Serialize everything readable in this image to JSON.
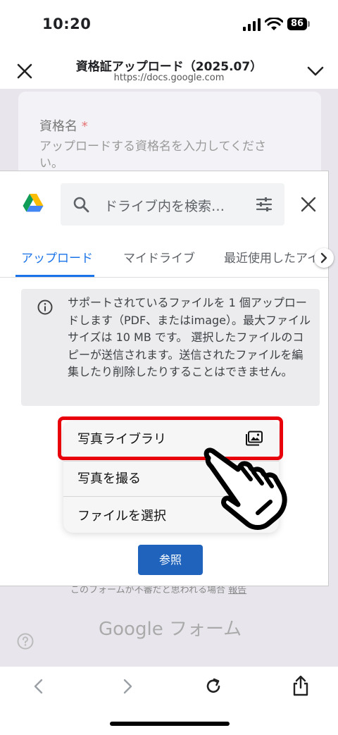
{
  "status": {
    "time": "10:20",
    "battery": "86"
  },
  "browser": {
    "title": "資格証アップロード（2025.07）",
    "url": "https://docs.google.com"
  },
  "form": {
    "field_label": "資格名",
    "required_mark": "*",
    "field_placeholder": "アップロードする資格名を入力してください。",
    "footer_note": "このフォームが不審だと思われる場合",
    "footer_link": "報告",
    "brand": "Google フォーム"
  },
  "picker": {
    "search_placeholder": "ドライブ内を検索…",
    "tabs": [
      {
        "label": "アップロード"
      },
      {
        "label": "マイドライブ"
      },
      {
        "label": "最近使用したアイテム"
      }
    ],
    "info_text": "サポートされているファイルを 1 個アップロードします（PDF、またはimage）。最大ファイルサイズは 10 MB です。 選択したファイルのコピーが送信されます。送信されたファイルを編集したり削除したりすることはできません。",
    "menu": {
      "items": [
        {
          "label": "写真ライブラリ",
          "icon": "photo-library-icon"
        },
        {
          "label": "写真を撮る"
        },
        {
          "label": "ファイルを選択"
        }
      ]
    },
    "browse_label": "参照"
  },
  "colors": {
    "accent": "#1a73e8",
    "browse_button": "#1f63bd",
    "highlight": "#e8000b"
  }
}
